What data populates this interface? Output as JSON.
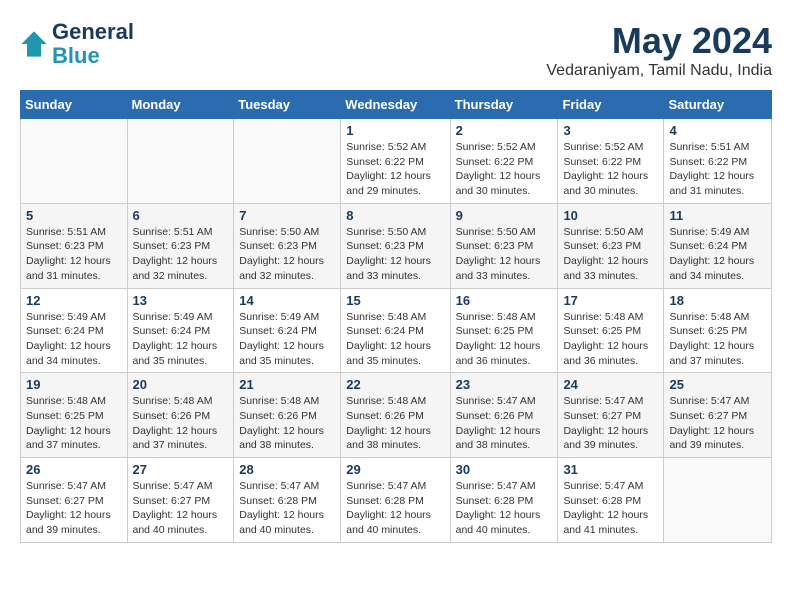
{
  "header": {
    "logo_line1": "General",
    "logo_line2": "Blue",
    "month_title": "May 2024",
    "location": "Vedaraniyam, Tamil Nadu, India"
  },
  "days_of_week": [
    "Sunday",
    "Monday",
    "Tuesday",
    "Wednesday",
    "Thursday",
    "Friday",
    "Saturday"
  ],
  "weeks": [
    [
      {
        "day": "",
        "info": ""
      },
      {
        "day": "",
        "info": ""
      },
      {
        "day": "",
        "info": ""
      },
      {
        "day": "1",
        "info": "Sunrise: 5:52 AM\nSunset: 6:22 PM\nDaylight: 12 hours\nand 29 minutes."
      },
      {
        "day": "2",
        "info": "Sunrise: 5:52 AM\nSunset: 6:22 PM\nDaylight: 12 hours\nand 30 minutes."
      },
      {
        "day": "3",
        "info": "Sunrise: 5:52 AM\nSunset: 6:22 PM\nDaylight: 12 hours\nand 30 minutes."
      },
      {
        "day": "4",
        "info": "Sunrise: 5:51 AM\nSunset: 6:22 PM\nDaylight: 12 hours\nand 31 minutes."
      }
    ],
    [
      {
        "day": "5",
        "info": "Sunrise: 5:51 AM\nSunset: 6:23 PM\nDaylight: 12 hours\nand 31 minutes."
      },
      {
        "day": "6",
        "info": "Sunrise: 5:51 AM\nSunset: 6:23 PM\nDaylight: 12 hours\nand 32 minutes."
      },
      {
        "day": "7",
        "info": "Sunrise: 5:50 AM\nSunset: 6:23 PM\nDaylight: 12 hours\nand 32 minutes."
      },
      {
        "day": "8",
        "info": "Sunrise: 5:50 AM\nSunset: 6:23 PM\nDaylight: 12 hours\nand 33 minutes."
      },
      {
        "day": "9",
        "info": "Sunrise: 5:50 AM\nSunset: 6:23 PM\nDaylight: 12 hours\nand 33 minutes."
      },
      {
        "day": "10",
        "info": "Sunrise: 5:50 AM\nSunset: 6:23 PM\nDaylight: 12 hours\nand 33 minutes."
      },
      {
        "day": "11",
        "info": "Sunrise: 5:49 AM\nSunset: 6:24 PM\nDaylight: 12 hours\nand 34 minutes."
      }
    ],
    [
      {
        "day": "12",
        "info": "Sunrise: 5:49 AM\nSunset: 6:24 PM\nDaylight: 12 hours\nand 34 minutes."
      },
      {
        "day": "13",
        "info": "Sunrise: 5:49 AM\nSunset: 6:24 PM\nDaylight: 12 hours\nand 35 minutes."
      },
      {
        "day": "14",
        "info": "Sunrise: 5:49 AM\nSunset: 6:24 PM\nDaylight: 12 hours\nand 35 minutes."
      },
      {
        "day": "15",
        "info": "Sunrise: 5:48 AM\nSunset: 6:24 PM\nDaylight: 12 hours\nand 35 minutes."
      },
      {
        "day": "16",
        "info": "Sunrise: 5:48 AM\nSunset: 6:25 PM\nDaylight: 12 hours\nand 36 minutes."
      },
      {
        "day": "17",
        "info": "Sunrise: 5:48 AM\nSunset: 6:25 PM\nDaylight: 12 hours\nand 36 minutes."
      },
      {
        "day": "18",
        "info": "Sunrise: 5:48 AM\nSunset: 6:25 PM\nDaylight: 12 hours\nand 37 minutes."
      }
    ],
    [
      {
        "day": "19",
        "info": "Sunrise: 5:48 AM\nSunset: 6:25 PM\nDaylight: 12 hours\nand 37 minutes."
      },
      {
        "day": "20",
        "info": "Sunrise: 5:48 AM\nSunset: 6:26 PM\nDaylight: 12 hours\nand 37 minutes."
      },
      {
        "day": "21",
        "info": "Sunrise: 5:48 AM\nSunset: 6:26 PM\nDaylight: 12 hours\nand 38 minutes."
      },
      {
        "day": "22",
        "info": "Sunrise: 5:48 AM\nSunset: 6:26 PM\nDaylight: 12 hours\nand 38 minutes."
      },
      {
        "day": "23",
        "info": "Sunrise: 5:47 AM\nSunset: 6:26 PM\nDaylight: 12 hours\nand 38 minutes."
      },
      {
        "day": "24",
        "info": "Sunrise: 5:47 AM\nSunset: 6:27 PM\nDaylight: 12 hours\nand 39 minutes."
      },
      {
        "day": "25",
        "info": "Sunrise: 5:47 AM\nSunset: 6:27 PM\nDaylight: 12 hours\nand 39 minutes."
      }
    ],
    [
      {
        "day": "26",
        "info": "Sunrise: 5:47 AM\nSunset: 6:27 PM\nDaylight: 12 hours\nand 39 minutes."
      },
      {
        "day": "27",
        "info": "Sunrise: 5:47 AM\nSunset: 6:27 PM\nDaylight: 12 hours\nand 40 minutes."
      },
      {
        "day": "28",
        "info": "Sunrise: 5:47 AM\nSunset: 6:28 PM\nDaylight: 12 hours\nand 40 minutes."
      },
      {
        "day": "29",
        "info": "Sunrise: 5:47 AM\nSunset: 6:28 PM\nDaylight: 12 hours\nand 40 minutes."
      },
      {
        "day": "30",
        "info": "Sunrise: 5:47 AM\nSunset: 6:28 PM\nDaylight: 12 hours\nand 40 minutes."
      },
      {
        "day": "31",
        "info": "Sunrise: 5:47 AM\nSunset: 6:28 PM\nDaylight: 12 hours\nand 41 minutes."
      },
      {
        "day": "",
        "info": ""
      }
    ]
  ]
}
